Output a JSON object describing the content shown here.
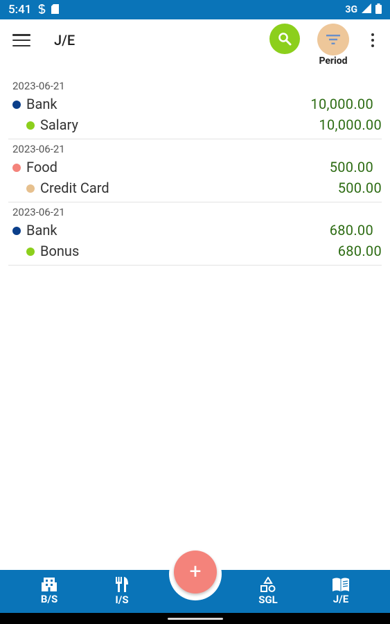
{
  "status_bar": {
    "time": "5:41",
    "network": "3G"
  },
  "app_bar": {
    "title": "J/E",
    "period_label": "Period",
    "search_icon": "search-icon",
    "filter_icon": "filter-icon"
  },
  "entries": [
    {
      "date": "2023-06-21",
      "debit": {
        "account": "Bank",
        "amount": "10,000.00",
        "color": "#0b3f8a"
      },
      "credit": {
        "account": "Salary",
        "amount": "10,000.00",
        "color": "#8ccf1c"
      }
    },
    {
      "date": "2023-06-21",
      "debit": {
        "account": "Food",
        "amount": "500.00",
        "color": "#f4837b"
      },
      "credit": {
        "account": "Credit Card",
        "amount": "500.00",
        "color": "#e6c08e"
      }
    },
    {
      "date": "2023-06-21",
      "debit": {
        "account": "Bank",
        "amount": "680.00",
        "color": "#0b3f8a"
      },
      "credit": {
        "account": "Bonus",
        "amount": "680.00",
        "color": "#8ccf1c"
      }
    }
  ],
  "bottom_nav": {
    "items": [
      {
        "label": "B/S",
        "icon": "building-icon"
      },
      {
        "label": "I/S",
        "icon": "utensils-icon"
      },
      {
        "label": "SGL",
        "icon": "shapes-icon"
      },
      {
        "label": "J/E",
        "icon": "book-icon"
      }
    ],
    "fab_label": "+"
  },
  "colors": {
    "primary": "#0a74b8",
    "search_button": "#8ccf1c",
    "period_button": "#eec79a",
    "fab": "#f4837b",
    "amount_text": "#2c6b12"
  }
}
